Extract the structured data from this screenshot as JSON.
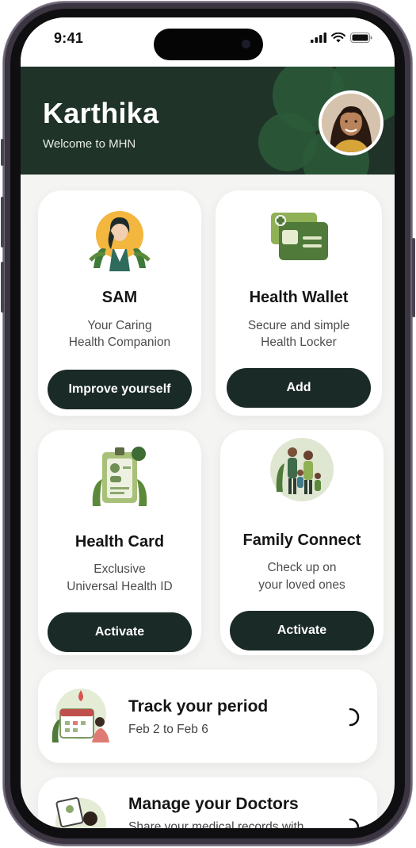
{
  "status_bar": {
    "time": "9:41"
  },
  "header": {
    "name": "Karthika",
    "welcome": "Welcome to MHN"
  },
  "cards": [
    {
      "title": "SAM",
      "subtitle_line1": "Your Caring",
      "subtitle_line2": "Health Companion",
      "button": "Improve yourself",
      "icon": "sam-assistant-illustration"
    },
    {
      "title": "Health Wallet",
      "subtitle_line1": "Secure and simple",
      "subtitle_line2": "Health Locker",
      "button": "Add",
      "icon": "wallet-illustration"
    },
    {
      "title": "Health Card",
      "subtitle_line1": "Exclusive",
      "subtitle_line2": "Universal Health ID",
      "button": "Activate",
      "icon": "id-card-illustration"
    },
    {
      "title": "Family Connect",
      "subtitle_line1": "Check up on",
      "subtitle_line2": "your loved ones",
      "button": "Activate",
      "icon": "family-illustration"
    }
  ],
  "track": {
    "title": "Track your period",
    "subtitle": "Feb 2 to Feb 6",
    "icon": "calendar-illustration"
  },
  "doctors": {
    "title": "Manage your Doctors",
    "subtitle": "Share your medical records with",
    "icon": "doctor-illustration"
  },
  "colors": {
    "header_bg": "#1f3328",
    "button_bg": "#1a2a27",
    "accent_green": "#5c8a3a"
  }
}
